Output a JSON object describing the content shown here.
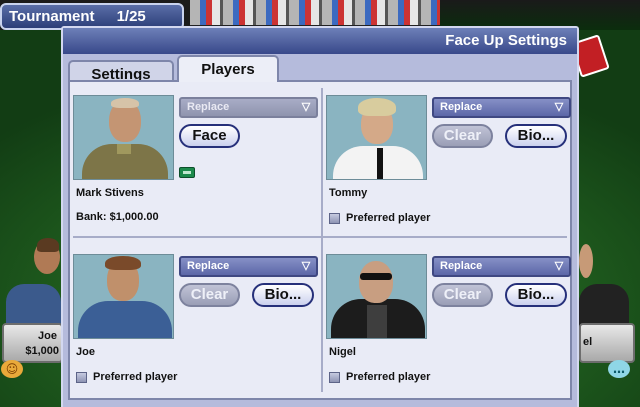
{
  "window": {
    "title": "Face Up Settings",
    "tabs": [
      {
        "label": "Settings",
        "selected": false
      },
      {
        "label": "Players",
        "selected": true
      }
    ]
  },
  "tournament": {
    "label": "Tournament",
    "progress": "1/25"
  },
  "background_players": {
    "left_name": "Joe",
    "left_amount": "$1,000",
    "right_name": "el"
  },
  "players": [
    {
      "name": "Mark Stivens",
      "select_value": "Replace",
      "select_enabled": false,
      "face_button": "Face",
      "bank_label": "Bank:",
      "bank_amount": "$1,000.00",
      "icon": "money-card-icon"
    },
    {
      "name": "Tommy",
      "select_value": "Replace",
      "select_enabled": true,
      "clear_button": "Clear",
      "bio_button": "Bio...",
      "preferred_label": "Preferred player",
      "preferred_checked": false
    },
    {
      "name": "Joe",
      "select_value": "Replace",
      "select_enabled": true,
      "clear_button": "Clear",
      "bio_button": "Bio...",
      "preferred_label": "Preferred player",
      "preferred_checked": false
    },
    {
      "name": "Nigel",
      "select_value": "Replace",
      "select_enabled": true,
      "clear_button": "Clear",
      "bio_button": "Bio...",
      "preferred_label": "Preferred player",
      "preferred_checked": false
    }
  ],
  "icons": {
    "dropdown_arrow": "chevron-down-icon",
    "checkbox": "checkbox-icon"
  },
  "colors": {
    "title_bar": "#38488a",
    "panel": "#e9ebf6",
    "felt": "#1f5c1e",
    "dropdown": "#5c67a8"
  }
}
